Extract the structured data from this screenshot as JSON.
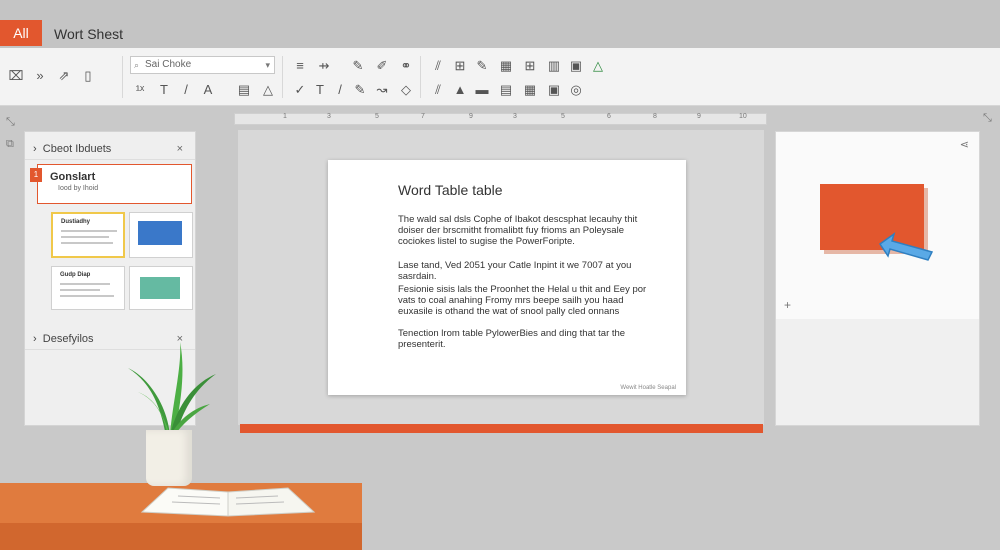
{
  "titlebar": {
    "app_tab": "All",
    "doc_title": "Wort Shest"
  },
  "ribbon": {
    "font_select": "Sai Choke",
    "icons_row1": [
      "format-icon",
      "forward-icon",
      "brush-icon",
      "page-icon",
      "list-icon",
      "arrow-icon",
      "pen-icon",
      "pen2-icon",
      "link-icon",
      "draw-icon",
      "shape-icon",
      "table-icon",
      "grid-icon",
      "table2-icon",
      "image-icon",
      "warning-icon"
    ],
    "icons_row2": [
      "subscript-icon",
      "text-icon",
      "italic-icon",
      "font-color-icon",
      "align-icon",
      "highlight-icon",
      "check-icon",
      "text-tool-icon",
      "pencil-icon",
      "line-icon",
      "curve-icon",
      "draw2-icon",
      "fill-icon",
      "shape2-icon",
      "table3-icon",
      "image2-icon",
      "circle-icon"
    ]
  },
  "slides_panel": {
    "header": "Cbeot Ibduets",
    "close": "×",
    "active_slide": {
      "title": "Gonslart",
      "subtitle": "Iood by Ihoid",
      "number": "1"
    },
    "thumbs": [
      {
        "title": "Dustiadhy"
      },
      {
        "title": ""
      },
      {
        "title": "Gudp Diap"
      },
      {
        "title": ""
      }
    ],
    "section2": "Desefyilos",
    "section2_close": "×"
  },
  "ruler": {
    "marks": [
      "1",
      "3",
      "5",
      "7",
      "9",
      "3",
      "5",
      "6",
      "8",
      "9",
      "10"
    ]
  },
  "slide": {
    "title": "Word Table table",
    "paragraphs": [
      "The wald sal dsls Cophe of Ibakot descsphat lecauhy thit doiser der brscmitht fromalibtt fuy frioms an Poleysale cociokes listel to sugise the PowerForipte.",
      "Lase tand, Ved 2051 your Catle Inpint it we 7007 at you sasrdain.",
      "Fesionie sisis lals the Proonhet the Helal u thit and Eey por vats to coal anahing Fromy mrs beepe sailh you haad euxasile is othand the wat of snool pally cled onnans",
      "Tenection lrom table PylowerBies and ding that tar the presenterit."
    ],
    "footer": "Wewit Hoatle Seapal"
  },
  "right_pane": {
    "plus": "+",
    "share": "⋖"
  },
  "colors": {
    "accent": "#e2572e",
    "ribbon_bg": "#f3f3f3",
    "window_bg": "#c9c9c9"
  }
}
